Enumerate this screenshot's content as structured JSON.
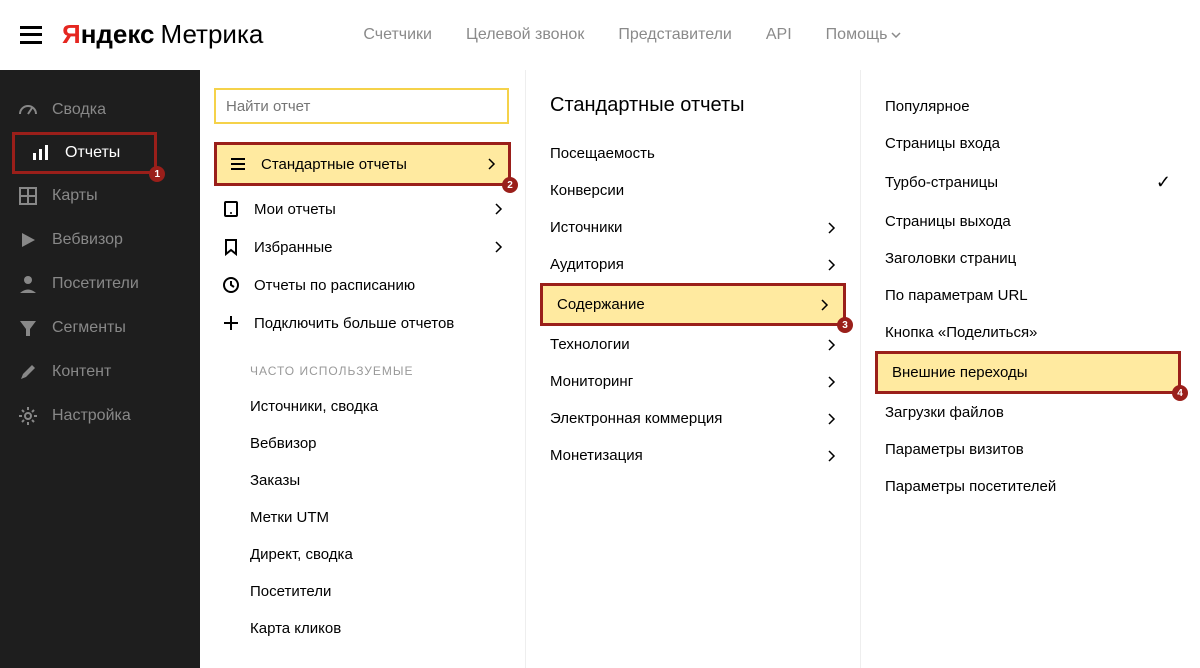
{
  "header": {
    "logo_y": "Я",
    "logo_andex": "ндекс",
    "logo_metrika": "Метрика",
    "nav": [
      "Счетчики",
      "Целевой звонок",
      "Представители",
      "API",
      "Помощь"
    ]
  },
  "sidebar": {
    "items": [
      {
        "label": "Сводка"
      },
      {
        "label": "Отчеты"
      },
      {
        "label": "Карты"
      },
      {
        "label": "Вебвизор"
      },
      {
        "label": "Посетители"
      },
      {
        "label": "Сегменты"
      },
      {
        "label": "Контент"
      },
      {
        "label": "Настройка"
      }
    ]
  },
  "search": {
    "placeholder": "Найти отчет"
  },
  "reports_menu": {
    "items": [
      {
        "label": "Стандартные отчеты"
      },
      {
        "label": "Мои отчеты"
      },
      {
        "label": "Избранные"
      },
      {
        "label": "Отчеты по расписанию"
      },
      {
        "label": "Подключить больше отчетов"
      }
    ],
    "frequent_header": "ЧАСТО ИСПОЛЬЗУЕМЫЕ",
    "frequent": [
      "Источники, сводка",
      "Вебвизор",
      "Заказы",
      "Метки UTM",
      "Директ, сводка",
      "Посетители",
      "Карта кликов"
    ]
  },
  "standard": {
    "title": "Стандартные отчеты",
    "items": [
      {
        "label": "Посещаемость",
        "arrow": false
      },
      {
        "label": "Конверсии",
        "arrow": false
      },
      {
        "label": "Источники",
        "arrow": true
      },
      {
        "label": "Аудитория",
        "arrow": true
      },
      {
        "label": "Содержание",
        "arrow": true
      },
      {
        "label": "Технологии",
        "arrow": true
      },
      {
        "label": "Мониторинг",
        "arrow": true
      },
      {
        "label": "Электронная коммерция",
        "arrow": true
      },
      {
        "label": "Монетизация",
        "arrow": true
      }
    ]
  },
  "content_sub": {
    "items": [
      {
        "label": "Популярное"
      },
      {
        "label": "Страницы входа"
      },
      {
        "label": "Турбо-страницы",
        "check": true
      },
      {
        "label": "Страницы выхода"
      },
      {
        "label": "Заголовки страниц"
      },
      {
        "label": "По параметрам URL"
      },
      {
        "label": "Кнопка «Поделиться»"
      },
      {
        "label": "Внешние переходы"
      },
      {
        "label": "Загрузки файлов"
      },
      {
        "label": "Параметры визитов"
      },
      {
        "label": "Параметры посетителей"
      }
    ]
  },
  "badges": {
    "b1": "1",
    "b2": "2",
    "b3": "3",
    "b4": "4"
  }
}
